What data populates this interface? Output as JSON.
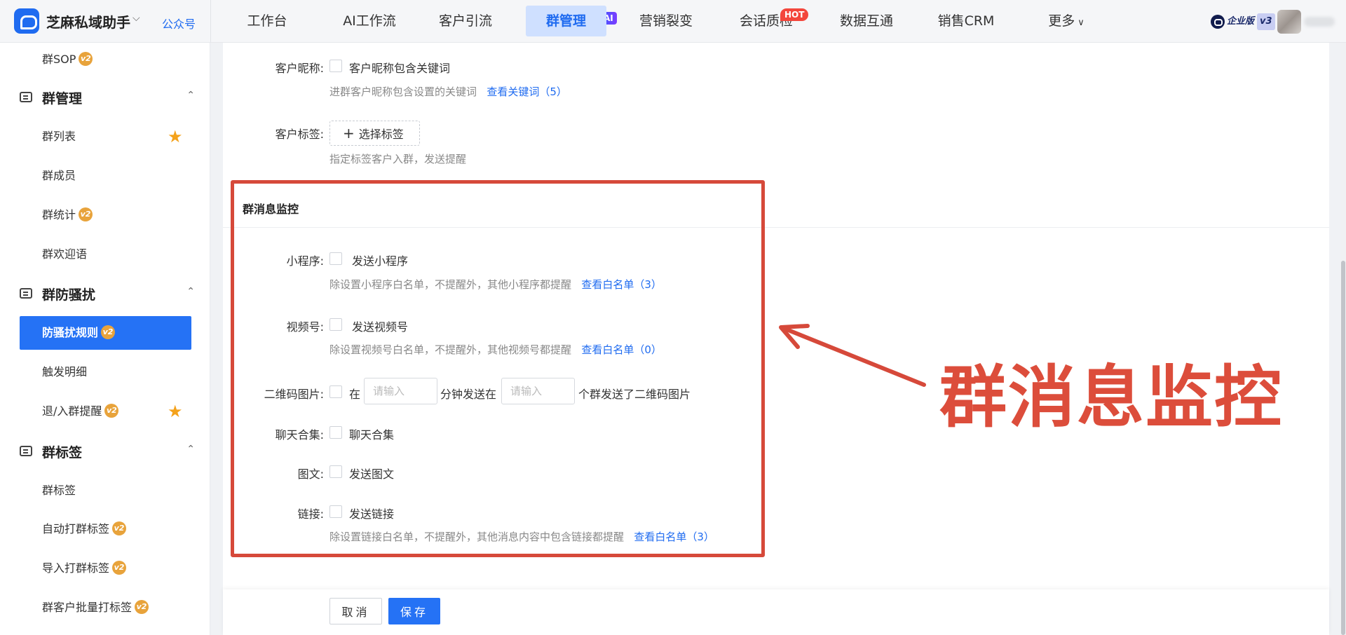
{
  "header": {
    "brand_name": "芝麻私域助手",
    "public_link": "公众号",
    "nav": [
      {
        "label": "工作台"
      },
      {
        "label": "AI工作流",
        "badge": "AI"
      },
      {
        "label": "客户引流"
      },
      {
        "label": "群管理",
        "active": true
      },
      {
        "label": "营销裂变"
      },
      {
        "label": "会话质检",
        "badge": "HOT"
      },
      {
        "label": "数据互通"
      },
      {
        "label": "销售CRM"
      },
      {
        "label": "更多"
      }
    ],
    "edition": "企业版",
    "edition_version": "v3"
  },
  "sidebar": {
    "top_item": {
      "label": "群SOP",
      "badge": "v2"
    },
    "groups": [
      {
        "title": "群管理",
        "icon": "chat-group-icon",
        "items": [
          {
            "label": "群列表",
            "star": true
          },
          {
            "label": "群成员"
          },
          {
            "label": "群统计",
            "badge": "v2"
          },
          {
            "label": "群欢迎语"
          }
        ]
      },
      {
        "title": "群防骚扰",
        "icon": "shield-chat-icon",
        "items": [
          {
            "label": "防骚扰规则",
            "badge": "v2",
            "active": true
          },
          {
            "label": "触发明细"
          },
          {
            "label": "退/入群提醒",
            "badge": "v2",
            "star": true
          }
        ]
      },
      {
        "title": "群标签",
        "icon": "tag-chat-icon",
        "items": [
          {
            "label": "群标签"
          },
          {
            "label": "自动打群标签",
            "badge": "v2"
          },
          {
            "label": "导入打群标签",
            "badge": "v2"
          },
          {
            "label": "群客户批量打标签",
            "badge": "v2"
          }
        ]
      }
    ]
  },
  "form": {
    "nickname": {
      "label": "客户昵称:",
      "checkbox": "客户昵称包含关键词",
      "hint": "进群客户昵称包含设置的关键词",
      "link": "查看关键词（5）"
    },
    "tags": {
      "label": "客户标签:",
      "button": "选择标签",
      "hint": "指定标签客户入群，发送提醒"
    },
    "section_title": "群消息监控",
    "mini_program": {
      "label": "小程序:",
      "checkbox": "发送小程序",
      "hint": "除设置小程序白名单，不提醒外，其他小程序都提醒",
      "link": "查看白名单（3）"
    },
    "channels": {
      "label": "视频号:",
      "checkbox": "发送视频号",
      "hint": "除设置视频号白名单，不提醒外，其他视频号都提醒",
      "link": "查看白名单（0）"
    },
    "qrcode": {
      "label": "二维码图片:",
      "prefix": "在",
      "input1_placeholder": "请输入",
      "middle": "分钟发送在",
      "input2_placeholder": "请输入",
      "suffix": "个群发送了二维码图片"
    },
    "chat_record": {
      "label": "聊天合集:",
      "checkbox": "聊天合集"
    },
    "rich_text": {
      "label": "图文:",
      "checkbox": "发送图文"
    },
    "link_msg": {
      "label": "链接:",
      "checkbox": "发送链接",
      "hint": "除设置链接白名单，不提醒外，其他消息内容中包含链接都提醒",
      "link": "查看白名单（3）"
    }
  },
  "annotation": {
    "text": "群消息监控",
    "color": "#dc4d3b"
  },
  "footer": {
    "cancel": "取消",
    "save": "保存"
  },
  "colors": {
    "accent": "#2572f5",
    "link": "#1f6bf0",
    "badge_gold": "#e8a33b",
    "star": "#f4a21b"
  }
}
